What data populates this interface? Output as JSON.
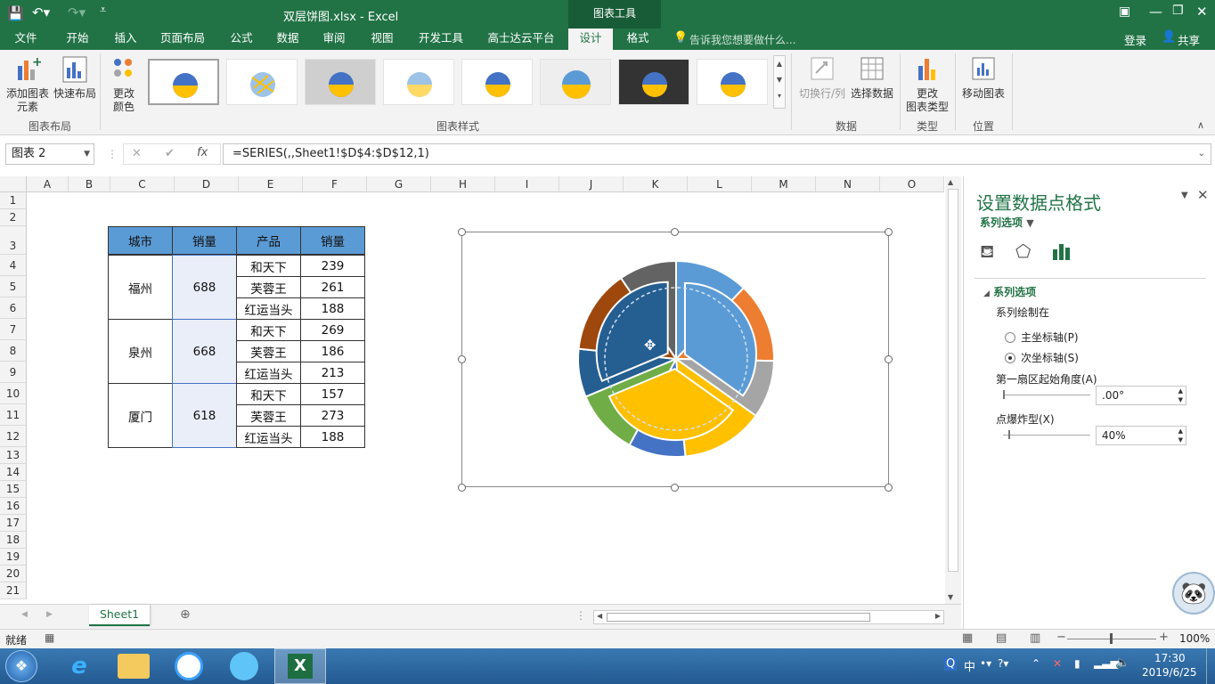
{
  "title": {
    "doc": "双层饼图.xlsx - Excel",
    "context_tool": "图表工具",
    "share": "共享",
    "login": "登录",
    "tellme": "告诉我您想要做什么..."
  },
  "tabs": [
    "文件",
    "开始",
    "插入",
    "页面布局",
    "公式",
    "数据",
    "审阅",
    "视图",
    "开发工具",
    "高士达云平台",
    "设计",
    "格式"
  ],
  "ribbon": {
    "add_element_1": "添加图表",
    "add_element_2": "元素",
    "quick_layout": "快速布局",
    "change_color_1": "更改",
    "change_color_2": "颜色",
    "group_layout": "图表布局",
    "group_styles": "图表样式",
    "switch_row_col": "切换行/列",
    "select_data": "选择数据",
    "group_data": "数据",
    "change_type_1": "更改",
    "change_type_2": "图表类型",
    "group_type": "类型",
    "move_chart": "移动图表",
    "group_location": "位置"
  },
  "formula": {
    "name_box": "图表 2",
    "fx": "fx",
    "cancel": "✕",
    "enter": "✔",
    "value": "=SERIES(,,Sheet1!$D$4:$D$12,1)"
  },
  "columns": [
    "A",
    "B",
    "C",
    "D",
    "E",
    "F",
    "G",
    "H",
    "I",
    "J",
    "K",
    "L",
    "M",
    "N",
    "O"
  ],
  "rows": [
    "1",
    "2",
    "3",
    "4",
    "5",
    "6",
    "7",
    "8",
    "9",
    "10",
    "11",
    "12",
    "13",
    "14",
    "15",
    "16",
    "17",
    "18",
    "19",
    "20",
    "21"
  ],
  "table": {
    "headers": [
      "城市",
      "销量",
      "产品",
      "销量"
    ],
    "groups": [
      {
        "city": "福州",
        "total": "688",
        "products": [
          [
            "和天下",
            "239"
          ],
          [
            "芙蓉王",
            "261"
          ],
          [
            "红运当头",
            "188"
          ]
        ]
      },
      {
        "city": "泉州",
        "total": "668",
        "products": [
          [
            "和天下",
            "269"
          ],
          [
            "芙蓉王",
            "186"
          ],
          [
            "红运当头",
            "213"
          ]
        ]
      },
      {
        "city": "厦门",
        "total": "618",
        "products": [
          [
            "和天下",
            "157"
          ],
          [
            "芙蓉王",
            "273"
          ],
          [
            "红运当头",
            "188"
          ]
        ]
      }
    ]
  },
  "pane": {
    "title": "设置数据点格式",
    "series_options_dropdown": "系列选项",
    "section": "系列选项",
    "plot_on": "系列绘制在",
    "primary_axis": "主坐标轴(P)",
    "secondary_axis": "次坐标轴(S)",
    "first_angle_label": "第一扇区起始角度(A)",
    "first_angle_value": ".00°",
    "explosion_label": "点爆炸型(X)",
    "explosion_value": "40%"
  },
  "sheet_tab": "Sheet1",
  "status": {
    "ready": "就绪",
    "zoom": "100%"
  },
  "taskbar": {
    "time": "17:30",
    "date": "2019/6/25",
    "ime": "中"
  },
  "chart_data": {
    "type": "pie",
    "outer_ring": {
      "values": [
        239,
        261,
        188,
        269,
        186,
        213,
        157,
        273,
        188
      ],
      "colors": [
        "#5b9bd5",
        "#ed7d31",
        "#a5a5a5",
        "#ffc000",
        "#4472c4",
        "#70ad47",
        "#255e91",
        "#9e480e",
        "#636363"
      ]
    },
    "inner_ring": {
      "values": [
        688,
        668,
        618
      ],
      "colors": [
        "#5b9bd5",
        "#ffc000",
        "#255e91"
      ],
      "explosion_percent": 40
    }
  },
  "colors": {
    "excel_green": "#217346",
    "header_blue": "#5b9bd5"
  }
}
